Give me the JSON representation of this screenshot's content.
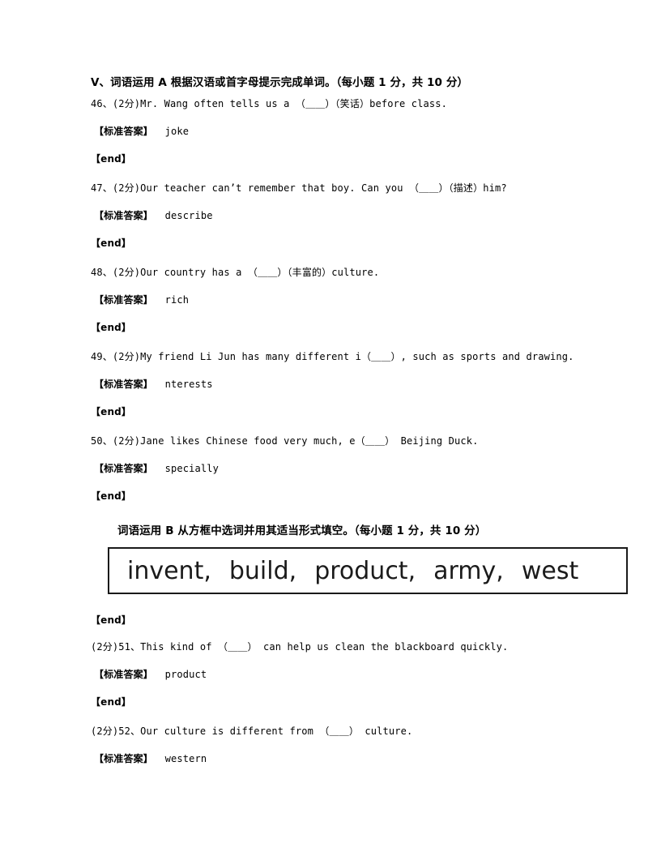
{
  "document": {
    "page_background": "#ffffff",
    "text_color": "#000000"
  },
  "section_a": {
    "heading": "Ⅴ、词语运用 A 根据汉语或首字母提示完成单词。（每小题 1 分，共 10 分）",
    "answer_label": "【标准答案】",
    "end_label": "【end】",
    "questions": [
      {
        "number": "46、",
        "points": "(2分)",
        "text_before": "Mr. Wang often tells us a （",
        "blank": "＿＿",
        "text_after": "）（笑话）before class.",
        "full_text": "46、(2分)Mr. Wang often tells us a （＿＿）（笑话）before class.",
        "answer": "joke"
      },
      {
        "number": "47、",
        "points": "(2分)",
        "full_text": "47、(2分)Our teacher can’t remember that boy. Can you （＿＿）（描述）him?",
        "answer": "describe"
      },
      {
        "number": "48、",
        "points": "(2分)",
        "full_text": "48、(2分)Our country has a （＿＿）（丰富的）culture.",
        "answer": "rich"
      },
      {
        "number": "49、",
        "points": "(2分)",
        "full_text": "49、(2分)My friend Li Jun has many different i（＿＿）, such as sports and drawing.",
        "answer": "nterests"
      },
      {
        "number": "50、",
        "points": "(2分)",
        "full_text": "50、(2分)Jane likes Chinese food very much, e（＿＿） Beijing Duck.",
        "answer": "specially"
      }
    ]
  },
  "section_b": {
    "heading": "词语运用 B 从方框中选词并用其适当形式填空。（每小题 1 分，共 10 分）",
    "word_bank": [
      "invent,",
      "build,",
      "product,",
      "army,",
      "west"
    ],
    "word_bank_border_color": "#1a1a1a",
    "word_bank_text_color": "#1b1b1b",
    "end_label_after_box": "【end】",
    "answer_label": "【标准答案】",
    "end_label": "【end】",
    "questions": [
      {
        "points": "(2分)",
        "number": "51、",
        "full_text": "(2分)51、This kind of （＿＿） can help us clean the blackboard quickly.",
        "answer": "product"
      },
      {
        "points": "(2分)",
        "number": "52、",
        "full_text": "(2分)52、Our culture is different from （＿＿） culture.",
        "answer": "western"
      }
    ]
  }
}
